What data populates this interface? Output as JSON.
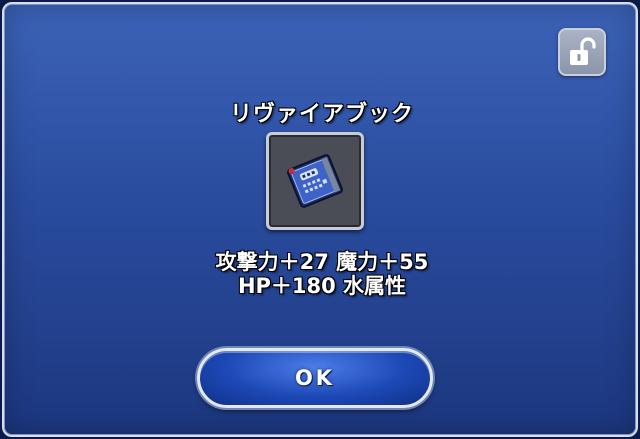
{
  "dialog": {
    "title": "リヴァイアブック",
    "stats_line1": "攻撃力＋27 魔力＋55",
    "stats_line2": "HP＋180 水属性",
    "ok_label": "OK"
  },
  "item": {
    "icon": "book-icon"
  },
  "lock": {
    "icon": "unlocked-padlock-icon",
    "state": "unlocked"
  },
  "colors": {
    "background_top": "#3c63b8",
    "background_bottom": "#1c377f",
    "ok_button": "#1d49b7",
    "text": "#ffffff"
  }
}
